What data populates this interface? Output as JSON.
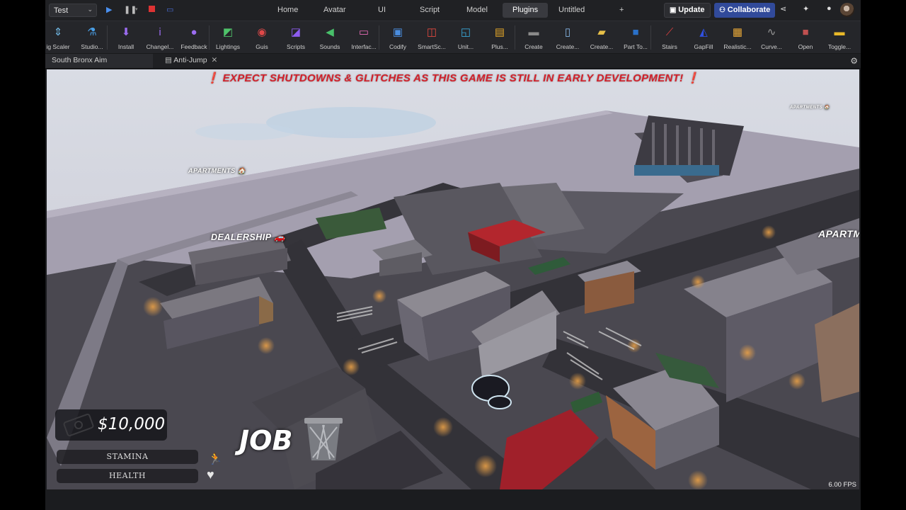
{
  "topbar": {
    "play_mode": "Test",
    "nav_tabs": [
      "Home",
      "Avatar",
      "UI",
      "Script",
      "Model",
      "Plugins",
      "Untitled",
      "+"
    ],
    "active_tab": "Plugins",
    "update_label": "Update",
    "collaborate_label": "Collaborate"
  },
  "ribbon": {
    "items": [
      {
        "label": "ig Scaler",
        "icon": "scaler-icon",
        "color": "#6fb5e0"
      },
      {
        "label": "Studio...",
        "icon": "flask-icon",
        "color": "#4aa0e8"
      },
      {
        "label": "Install",
        "icon": "download-arrow-icon",
        "color": "#9b6cf0"
      },
      {
        "label": "Changel...",
        "icon": "info-icon",
        "color": "#9b6cf0"
      },
      {
        "label": "Feedback",
        "icon": "chat-bubble-icon",
        "color": "#9b6cf0"
      },
      {
        "label": "Lightings",
        "icon": "lighting-icon",
        "color": "#4fc36a"
      },
      {
        "label": "Guis",
        "icon": "gui-icon",
        "color": "#e04848"
      },
      {
        "label": "Scripts",
        "icon": "script-icon",
        "color": "#8d5cf0"
      },
      {
        "label": "Sounds",
        "icon": "sound-icon",
        "color": "#48c06a"
      },
      {
        "label": "Interfac...",
        "icon": "interface-icon",
        "color": "#e86cb8"
      },
      {
        "label": "Codify",
        "icon": "codify-icon",
        "color": "#4a8ee0"
      },
      {
        "label": "SmartSc...",
        "icon": "smartscale-icon",
        "color": "#e0483f"
      },
      {
        "label": "Unit...",
        "icon": "unit-icon",
        "color": "#38a8d8"
      },
      {
        "label": "Plus...",
        "icon": "plus-doc-icon",
        "color": "#e0a428"
      },
      {
        "label": "Create",
        "icon": "create-icon",
        "color": "#8a8a8a"
      },
      {
        "label": "Create...",
        "icon": "create-doc-icon",
        "color": "#88b8e8"
      },
      {
        "label": "Create...",
        "icon": "create-folder-icon",
        "color": "#e8c048"
      },
      {
        "label": "Part To...",
        "icon": "part-icon",
        "color": "#2a70c8"
      },
      {
        "label": "Stairs",
        "icon": "stairs-icon",
        "color": "#e04040"
      },
      {
        "label": "GapFill",
        "icon": "gapfill-icon",
        "color": "#3050e0"
      },
      {
        "label": "Realistic...",
        "icon": "landscape-icon",
        "color": "#e8a838"
      },
      {
        "label": "Curve...",
        "icon": "curve-icon",
        "color": "#9a9a9a"
      },
      {
        "label": "Open",
        "icon": "open-icon",
        "color": "#c05050"
      },
      {
        "label": "Toggle...",
        "icon": "toggle-icon",
        "color": "#e8b828"
      }
    ]
  },
  "file_tabs": [
    {
      "label": "South Bronx Aim Trainer.rbxl",
      "active": true
    },
    {
      "label": "Anti-Jump",
      "active": false
    }
  ],
  "game": {
    "banner": "❗ EXPECT SHUTDOWNS & GLITCHES AS THIS GAME IS STILL IN EARLY DEVELOPMENT! ❗",
    "billboards": {
      "apartments_left": "APARTMENTS 🏠",
      "dealership": "DEALERSHIP 🚗",
      "apartments_right": "APARTM",
      "apartments_far": "APARTMENTS 🏠"
    },
    "fps": "6.00 FPS",
    "hud": {
      "money": "$10,000",
      "stamina_label": "STAMINA",
      "health_label": "HEALTH",
      "job_label": "JOB"
    }
  },
  "colors": {
    "banner_red": "#d2202a",
    "collaborate_blue": "#314a9a",
    "studio_dark": "#202124"
  }
}
